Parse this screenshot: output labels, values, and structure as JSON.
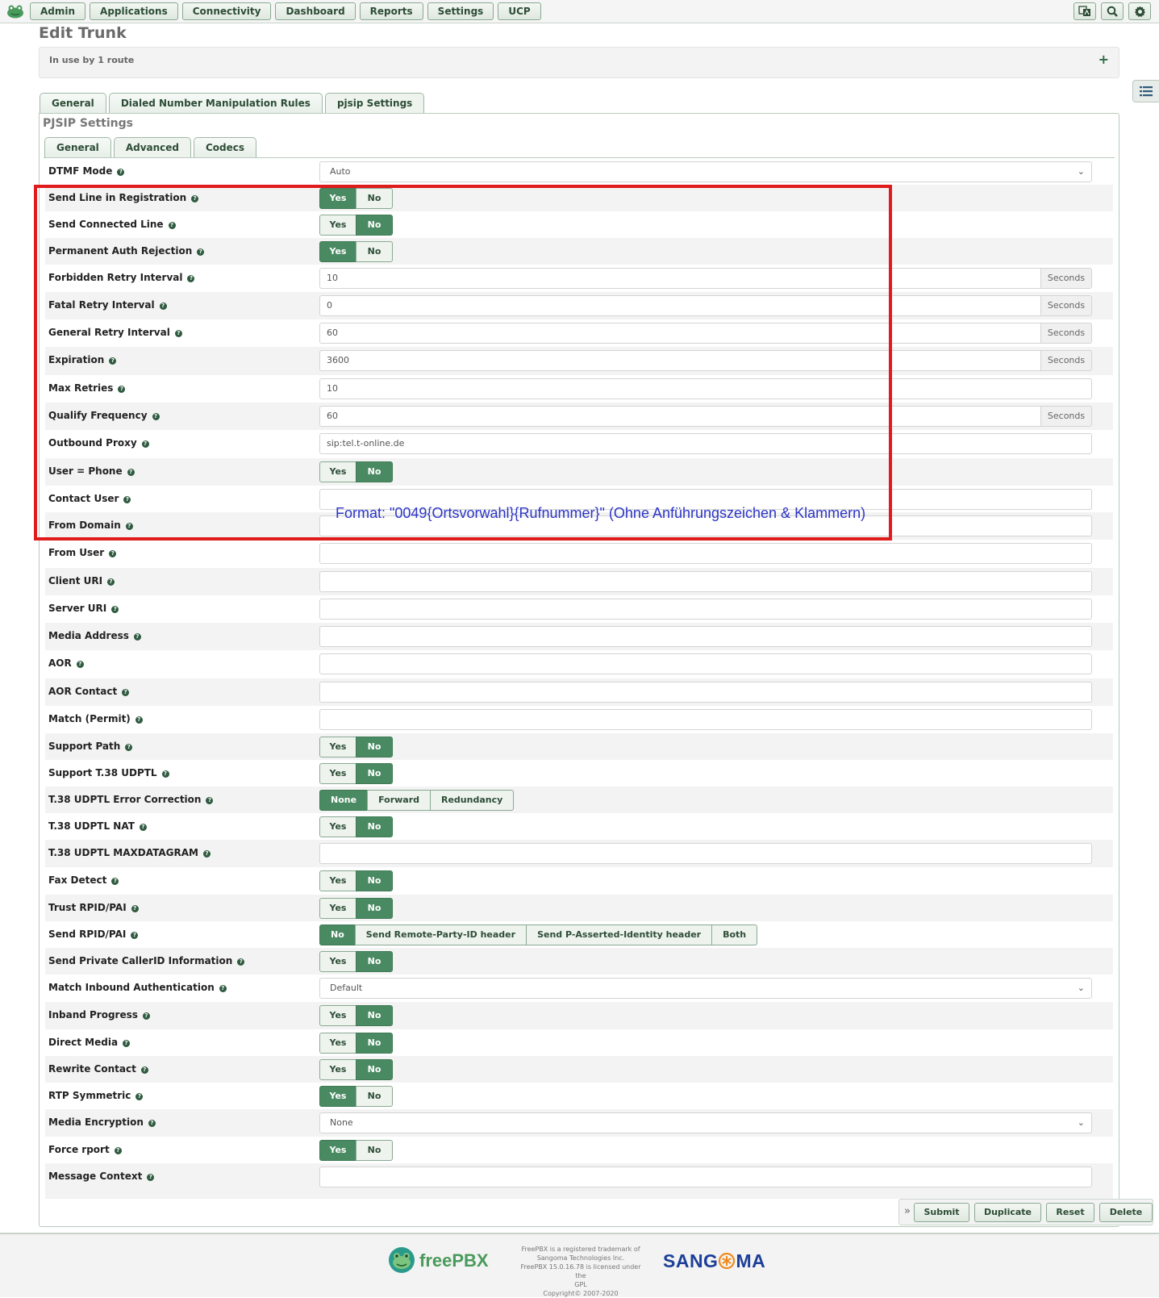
{
  "nav": [
    "Admin",
    "Applications",
    "Connectivity",
    "Dashboard",
    "Reports",
    "Settings",
    "UCP"
  ],
  "top_icons": [
    "translate-icon",
    "search-icon",
    "gear-icon"
  ],
  "page_title": "Edit Trunk",
  "in_use": "In use by 1 route",
  "tabs": [
    "General",
    "Dialed Number Manipulation Rules",
    "pjsip Settings"
  ],
  "active_tab": "pjsip Settings",
  "panel_title": "PJSIP Settings",
  "subtabs": [
    "General",
    "Advanced",
    "Codecs"
  ],
  "active_subtab": "Advanced",
  "fields": {
    "dtmf_mode": {
      "label": "DTMF Mode",
      "value": "Auto"
    },
    "send_line": {
      "label": "Send Line in Registration",
      "options": [
        "Yes",
        "No"
      ],
      "selected": "Yes"
    },
    "send_connected": {
      "label": "Send Connected Line",
      "options": [
        "Yes",
        "No"
      ],
      "selected": "No"
    },
    "perm_auth": {
      "label": "Permanent Auth Rejection",
      "options": [
        "Yes",
        "No"
      ],
      "selected": "Yes"
    },
    "forbidden_retry": {
      "label": "Forbidden Retry Interval",
      "value": "10",
      "unit": "Seconds"
    },
    "fatal_retry": {
      "label": "Fatal Retry Interval",
      "value": "0",
      "unit": "Seconds"
    },
    "general_retry": {
      "label": "General Retry Interval",
      "value": "60",
      "unit": "Seconds"
    },
    "expiration": {
      "label": "Expiration",
      "value": "3600",
      "unit": "Seconds"
    },
    "max_retries": {
      "label": "Max Retries",
      "value": "10"
    },
    "qualify_freq": {
      "label": "Qualify Frequency",
      "value": "60",
      "unit": "Seconds"
    },
    "outbound_proxy": {
      "label": "Outbound Proxy",
      "value": "sip:tel.t-online.de"
    },
    "user_phone": {
      "label": "User = Phone",
      "options": [
        "Yes",
        "No"
      ],
      "selected": "No"
    },
    "contact_user": {
      "label": "Contact User",
      "value": ""
    },
    "from_domain": {
      "label": "From Domain",
      "value": ""
    },
    "from_user": {
      "label": "From User",
      "value": ""
    },
    "client_uri": {
      "label": "Client URI",
      "value": ""
    },
    "server_uri": {
      "label": "Server URI",
      "value": ""
    },
    "media_address": {
      "label": "Media Address",
      "value": ""
    },
    "aor": {
      "label": "AOR",
      "value": ""
    },
    "aor_contact": {
      "label": "AOR Contact",
      "value": ""
    },
    "match_permit": {
      "label": "Match (Permit)",
      "value": ""
    },
    "support_path": {
      "label": "Support Path",
      "options": [
        "Yes",
        "No"
      ],
      "selected": "No"
    },
    "support_t38": {
      "label": "Support T.38 UDPTL",
      "options": [
        "Yes",
        "No"
      ],
      "selected": "No"
    },
    "t38_ec": {
      "label": "T.38 UDPTL Error Correction",
      "options": [
        "None",
        "Forward",
        "Redundancy"
      ],
      "selected": "None"
    },
    "t38_nat": {
      "label": "T.38 UDPTL NAT",
      "options": [
        "Yes",
        "No"
      ],
      "selected": "No"
    },
    "t38_maxdg": {
      "label": "T.38 UDPTL MAXDATAGRAM",
      "value": ""
    },
    "fax_detect": {
      "label": "Fax Detect",
      "options": [
        "Yes",
        "No"
      ],
      "selected": "No"
    },
    "trust_rpid": {
      "label": "Trust RPID/PAI",
      "options": [
        "Yes",
        "No"
      ],
      "selected": "No"
    },
    "send_rpid": {
      "label": "Send RPID/PAI",
      "options": [
        "No",
        "Send Remote-Party-ID header",
        "Send P-Asserted-Identity header",
        "Both"
      ],
      "selected": "No"
    },
    "send_private": {
      "label": "Send Private CallerID Information",
      "options": [
        "Yes",
        "No"
      ],
      "selected": "No"
    },
    "match_inbound": {
      "label": "Match Inbound Authentication",
      "value": "Default"
    },
    "inband_progress": {
      "label": "Inband Progress",
      "options": [
        "Yes",
        "No"
      ],
      "selected": "No"
    },
    "direct_media": {
      "label": "Direct Media",
      "options": [
        "Yes",
        "No"
      ],
      "selected": "No"
    },
    "rewrite_contact": {
      "label": "Rewrite Contact",
      "options": [
        "Yes",
        "No"
      ],
      "selected": "No"
    },
    "rtp_symmetric": {
      "label": "RTP Symmetric",
      "options": [
        "Yes",
        "No"
      ],
      "selected": "Yes"
    },
    "media_encryption": {
      "label": "Media Encryption",
      "value": "None"
    },
    "force_rport": {
      "label": "Force rport",
      "options": [
        "Yes",
        "No"
      ],
      "selected": "Yes"
    },
    "message_context": {
      "label": "Message Context",
      "value": ""
    }
  },
  "annotation": "Format: \"0049{Ortsvorwahl}{Rufnummer}\" (Ohne Anführungszeichen & Klammern)",
  "annotation_color": "#2c35c8",
  "highlight_color": "#e01b1b",
  "actions": {
    "chevron": "»",
    "submit": "Submit",
    "duplicate": "Duplicate",
    "reset": "Reset",
    "delete": "Delete"
  },
  "footer": {
    "brand": "freePBX",
    "legal": [
      "FreePBX is a registered trademark of",
      "Sangoma Technologies Inc.",
      "FreePBX 15.0.16.78 is licensed under the",
      "GPL",
      "Copyright© 2007-2020"
    ],
    "company_a": "SANG",
    "company_b": "MA"
  }
}
